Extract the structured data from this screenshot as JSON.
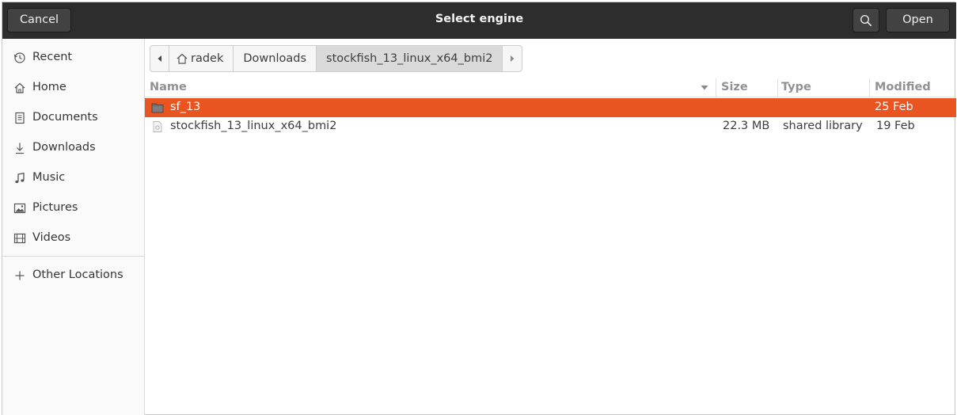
{
  "dialog": {
    "title": "Select engine",
    "cancel_label": "Cancel",
    "open_label": "Open",
    "search_icon": "search-icon"
  },
  "sidebar": {
    "items": [
      {
        "label": "Recent",
        "icon": "clock-icon"
      },
      {
        "label": "Home",
        "icon": "home-icon"
      },
      {
        "label": "Documents",
        "icon": "document-icon"
      },
      {
        "label": "Downloads",
        "icon": "download-icon"
      },
      {
        "label": "Music",
        "icon": "music-note-icon"
      },
      {
        "label": "Pictures",
        "icon": "picture-icon"
      },
      {
        "label": "Videos",
        "icon": "film-icon"
      }
    ],
    "other_locations": {
      "label": "Other Locations",
      "icon": "plus-icon"
    }
  },
  "pathbar": {
    "segments": [
      "radek",
      "Downloads",
      "stockfish_13_linux_x64_bmi2"
    ],
    "active_index": 2
  },
  "columns": {
    "name": "Name",
    "size": "Size",
    "type": "Type",
    "modified": "Modified"
  },
  "files": [
    {
      "name": "sf_13",
      "size": "",
      "type": "",
      "modified": "25 Feb",
      "icon": "folder-icon",
      "selected": true
    },
    {
      "name": "stockfish_13_linux_x64_bmi2",
      "size": "22.3 MB",
      "type": "shared library",
      "modified": "19 Feb",
      "icon": "file-icon",
      "selected": false
    }
  ],
  "colors": {
    "header_bg": "#2d2d2d",
    "selection": "#e95420"
  }
}
